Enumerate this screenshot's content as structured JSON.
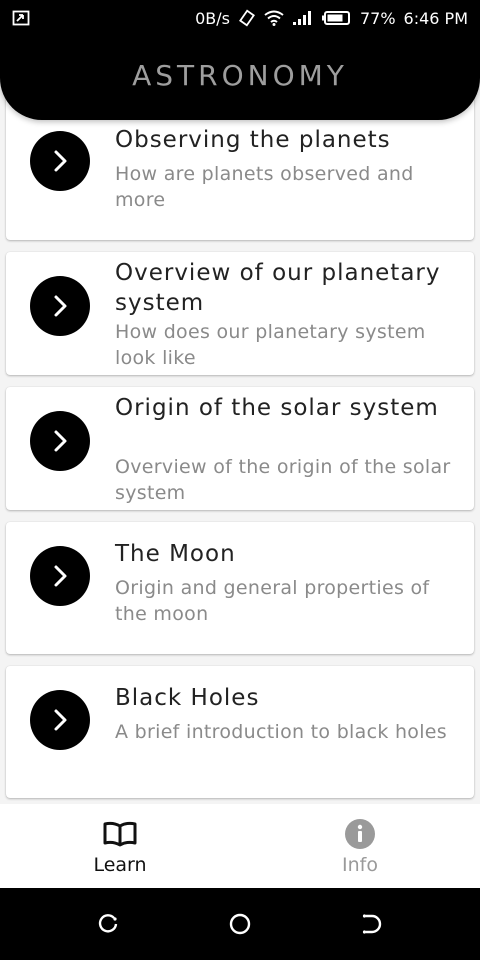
{
  "status_bar": {
    "net_speed": "0B/s",
    "battery": "77%",
    "time": "6:46 PM"
  },
  "header": {
    "title": "ASTRONOMY"
  },
  "topics": [
    {
      "title": "Observing the planets",
      "subtitle": "How are planets observed and more",
      "icon": "chevron-right-icon"
    },
    {
      "title": "Overview of our planetary system",
      "subtitle": "How does our planetary system look like",
      "icon": "chevron-right-icon"
    },
    {
      "title": "Origin of the solar system",
      "subtitle": "Overview of the origin of the solar system",
      "icon": "chevron-right-icon"
    },
    {
      "title": "The Moon",
      "subtitle": "Origin and general properties of the moon",
      "icon": "chevron-right-icon"
    },
    {
      "title": "Black Holes",
      "subtitle": "A brief introduction to black holes",
      "icon": "chevron-right-icon"
    }
  ],
  "bottom_nav": {
    "items": [
      {
        "label": "Learn",
        "icon": "book-icon",
        "active": true
      },
      {
        "label": "Info",
        "icon": "info-icon",
        "active": false
      }
    ]
  },
  "colors": {
    "header_bg": "#000000",
    "title_text": "#9e9e9e",
    "active_nav": "#111111",
    "inactive_nav": "#9a9a9a"
  }
}
